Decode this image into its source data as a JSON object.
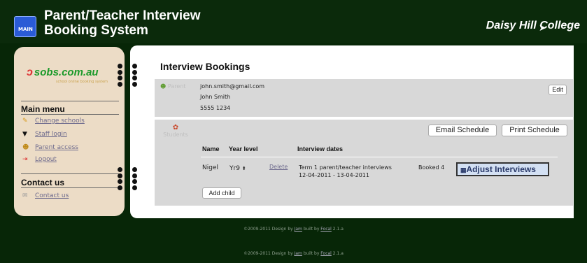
{
  "header": {
    "title_line1": "Parent/Teacher Interview",
    "title_line2": "Booking System",
    "school_name": "Daisy Hill College",
    "logo_text": "MAIN"
  },
  "sidebar": {
    "brand": "sobs.com.au",
    "brand_tagline": "school online booking system",
    "main_menu_heading": "Main menu",
    "items": [
      {
        "label": "Change schools",
        "icon": "pencil-icon"
      },
      {
        "label": "Staff login",
        "icon": "mortarboard-icon"
      },
      {
        "label": "Parent access",
        "icon": "person-icon"
      },
      {
        "label": "Logout",
        "icon": "logout-icon"
      }
    ],
    "contact_heading": "Contact us",
    "contact_item": "Contact us"
  },
  "main": {
    "title": "Interview Bookings",
    "parent": {
      "label": "Parent",
      "email": "john.smith@gmail.com",
      "name": "John Smith",
      "phone": "5555 1234",
      "edit_label": "Edit"
    },
    "students": {
      "label": "Students",
      "email_schedule_label": "Email Schedule",
      "print_schedule_label": "Print Schedule",
      "columns": [
        "Name",
        "Year level",
        "Interview dates"
      ],
      "rows": [
        {
          "name": "Nigel",
          "year": "Yr9",
          "delete_label": "Delete",
          "interview_line1": "Term 1 parent/teacher interviews",
          "interview_line2": "12-04-2011 - 13-04-2011",
          "booked": "Booked 4",
          "adjust_label": "Adjust Interviews"
        }
      ],
      "add_child_label": "Add child"
    }
  },
  "footer": {
    "line1_prefix": "©2009-2011 Design by ",
    "line1_link1": "Jam",
    "line1_mid": " built by ",
    "line1_link2": "Focal",
    "line1_suffix": " 2.1.a",
    "line2_prefix": "©2009-2011 Design by ",
    "line2_link1": "Jam",
    "line2_mid": " built by ",
    "line2_link2": "Focal",
    "line2_suffix": " 2.1.a"
  },
  "colors": {
    "background": "#072607",
    "sidebar": "#ecdcc6",
    "panel": "#d8d8d8",
    "brand_green": "#1b9a2a",
    "link": "#6d6a8d"
  }
}
